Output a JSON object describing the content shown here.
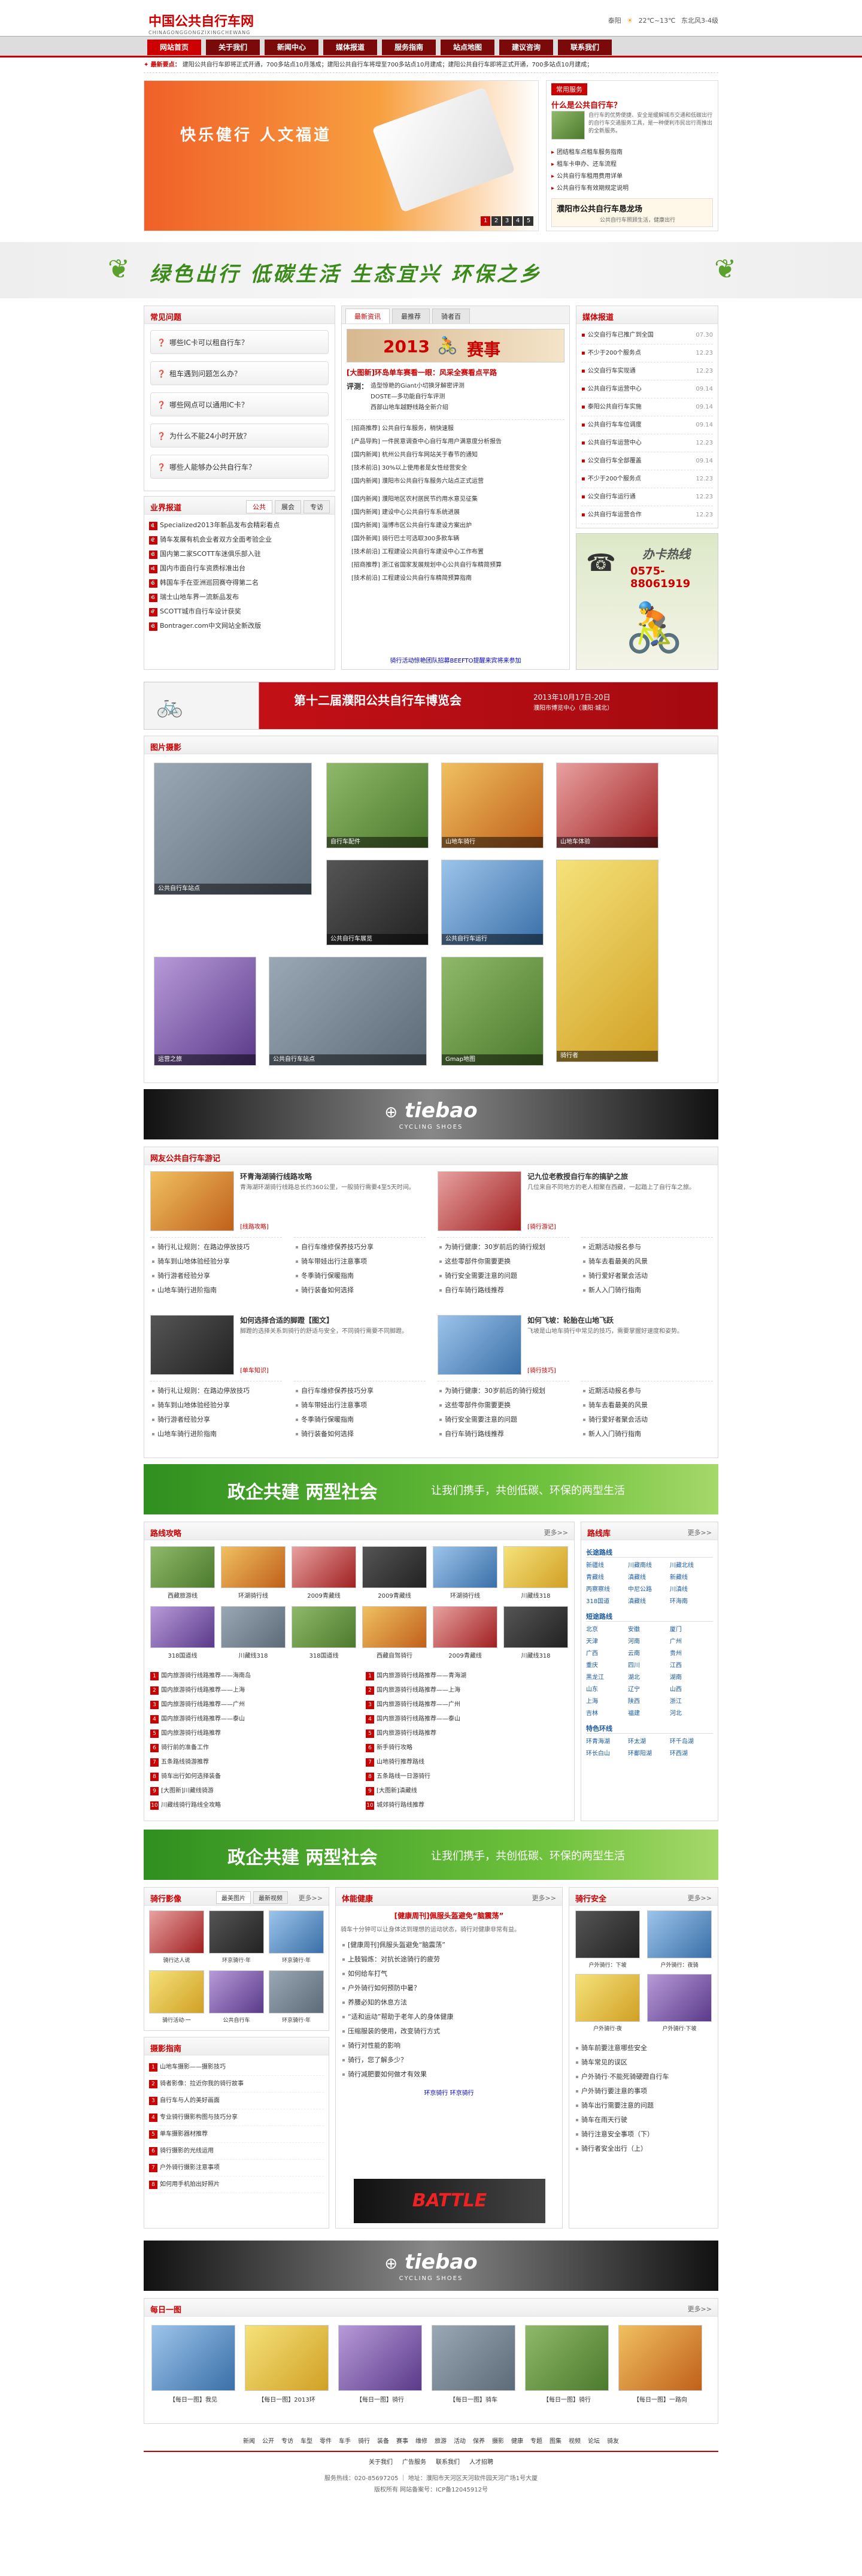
{
  "header": {
    "logo_cn": "中国公共自行车网",
    "logo_en": "CHINAGONGGONGZIXINGCHEWANG",
    "weather_city": "泰阳",
    "weather_temp": "22℃~13℃",
    "weather_wind": "东北风3-4级"
  },
  "nav": [
    "网站首页",
    "关于我们",
    "新闻中心",
    "媒体报道",
    "服务指南",
    "站点地图",
    "建议咨询",
    "联系我们"
  ],
  "notice": {
    "label": "最新要点：",
    "text": "建阳公共自行车即将正式开通，700多站点10月落成；建阳公共自行车将增至700多站点10月建成；建阳公共自行车即将正式开通，700多站点10月建成；"
  },
  "hero": {
    "slogan": "快乐健行 人文福道",
    "pages": [
      "1",
      "2",
      "3",
      "4",
      "5"
    ]
  },
  "intro": {
    "title": "常用服务",
    "question": "什么是公共自行车？",
    "desc": "自行车的优势便捷、安全是缓解城市交通和低碳出行的自行车交通服务工具，是一种便利市民出行而推出的全新服务。",
    "links": [
      "办理租车卡",
      "联系电话"
    ],
    "items": [
      "团结租车点租车服务指南",
      "租车卡申办、还车流程",
      "公共自行车租用费用详单",
      "公共自行车有效期规定说明"
    ],
    "ad_title": "濮阳市公共自行车恳龙场",
    "ad_sub": "公共自行车照顾生活，健康出行"
  },
  "slogan_bar": {
    "text": "绿色出行 低碳生活 生态宜兴 环保之乡"
  },
  "faq": {
    "title": "常见问题",
    "items": [
      "哪些IC卡可以租自行车？",
      "租车遇到问题怎么办？",
      "哪些网点可以通用IC卡？",
      "为什么不能24小时开放？",
      "哪些人能够办公共自行车？"
    ]
  },
  "yezhe": {
    "title": "业界报道",
    "tabs": [
      "公共",
      "展会",
      "专访"
    ],
    "items": [
      "Specialized2013年新品发布会精彩看点",
      "骑车发展有机会业者双方全面考验企业",
      "国内第二家SCOTT车迷俱乐部入驻",
      "国内市面自行车资质标准出台",
      "韩国车手在亚洲巡回赛夺得第二名",
      "瑞士山地车界一流新品发布",
      "SCOTT城市自行车设计获奖",
      "Bontrager.com中文网站全新改版"
    ]
  },
  "news": {
    "tabs": [
      "最新资讯",
      "最推荐",
      "骑者百"
    ],
    "banner_year": "2013",
    "banner_text": "赛事",
    "headline": "[大图新]环岛单车赛看一眼：风采全赛看点平路",
    "review_label": "评测：",
    "reviews": [
      "造型惊艳的Giant小切换牙解密评测",
      "DOSTE—多功能自行车评测",
      "西部山地车越野线路全新介绍"
    ],
    "items": [
      "[招商推荐] 公共自行车服务，稍快速服",
      "[产品导购] 一件民意调查中心自行车用户满意度分析报告",
      "[国内新闻] 杭州公共自行车网站关于春节的通知",
      "[技术前沿] 30%以上使用者是女性经营安全",
      "[国内新闻] 濮阳市公共自行车服务六站点正式运营",
      "[国内新闻] 濮阳地区农村居民节约用水意见征集",
      "[国内新闻] 建设中心公共自行车系统进展",
      "[国内新闻] 淄博市区公共自行车建设方案出炉",
      "[国外新闻] 骑行巴士可选取300多款车辆",
      "[技术前沿] 工程建设公共自行车建设中心工作布置",
      "[招商推荐] 浙江省国家发展规划中心公共自行车精简预算",
      "[技术前沿] 工程建设公共自行车精简预算指南"
    ],
    "footer": "骑行活动惊艳团队招募BEEFTO提醒来宾将来参加"
  },
  "media": {
    "title": "媒体报道",
    "items": [
      [
        "公交自行车已推广到全国",
        "07.30"
      ],
      [
        "不少于200个服务点",
        "12.23"
      ],
      [
        "公交自行车实现通",
        "12.23"
      ],
      [
        "公共自行车运营中心",
        "09.14"
      ],
      [
        "泰阳公共自行车实施",
        "09.14"
      ],
      [
        "公共自行车车位调度",
        "09.14"
      ],
      [
        "公共自行车运营中心",
        "12.23"
      ],
      [
        "公交自行车全部覆盖",
        "09.14"
      ],
      [
        "不少于200个服务点",
        "12.23"
      ],
      [
        "公交自行车运行通",
        "12.23"
      ],
      [
        "公共自行车运营合作",
        "12.23"
      ]
    ],
    "hotline_label": "办卡热线",
    "hotline": "0575-88061919"
  },
  "expo": {
    "title": "第十二届濮阳公共自行车博览会",
    "date": "2013年10月17日-20日",
    "place": "濮阳市博览中心（濮阳·城北）"
  },
  "photos": {
    "title": "图片摄影",
    "caps": [
      "公共自行车站点",
      "自行车配件",
      "山地车骑行",
      "山地车体验",
      "公共自行车展览",
      "公共自行车运行",
      "骑行者",
      "运营之旅",
      "公共自行车站点",
      "Gmap地图"
    ]
  },
  "ad_tiebao": {
    "brand": "tiebao",
    "sub": "CYCLING SHOES"
  },
  "travel": {
    "title": "网友公共自行车游记",
    "a": [
      {
        "title": "环青海湖骑行线路攻略",
        "desc": "青海湖环湖骑行线路总长约360公里，一般骑行需要4至5天时间。",
        "more": "[线路攻略]"
      },
      {
        "title": "记九位老教授自行车的搞驴之旅",
        "desc": "几位来自不同地方的老人相聚在西藏，一起踏上了自行车之旅。",
        "more": "[骑行游记]"
      },
      {
        "title": "如何选择合适的脚蹬【图文】",
        "desc": "脚蹬的选择关系到骑行的舒适与安全，不同骑行需要不同脚蹬。",
        "more": "[单车知识]"
      },
      {
        "title": "如何飞坡：轮胎在山地飞跃",
        "desc": "飞坡是山地车骑行中常见的技巧，需要掌握好速度和姿势。",
        "more": "[骑行技巧]"
      }
    ],
    "list1": [
      "骑行礼让规则：在路边停放技巧",
      "骑车到山地体验经验分享",
      "骑行游者经验分享",
      "山地车骑行进阶指南"
    ],
    "list2": [
      "自行车维修保养技巧分享",
      "骑车带娃出行注意事项",
      "冬季骑行保暖指南",
      "骑行装备如何选择"
    ],
    "list3": [
      "为骑行健康：30岁前后的骑行规划",
      "这些零部件你需要更换",
      "骑行安全需要注意的问题",
      "自行车骑行路线推荐"
    ],
    "list4": [
      "近期活动报名参与",
      "骑车去看最美的风景",
      "骑行爱好者聚会活动",
      "新人入门骑行指南"
    ]
  },
  "govbar1": {
    "big": "政企共建 两型社会",
    "small": "让我们携手，共创低碳、环保的两型生活"
  },
  "routes": {
    "title": "路线攻略",
    "more": "更多>>",
    "caps": [
      "西藏旅游线",
      "环湖骑行线",
      "2009青藏线",
      "2009青藏线",
      "环湖骑行线",
      "川藏线318",
      "318国道线",
      "川藏线318",
      "318国道线",
      "西藏自驾骑行",
      "2009青藏线",
      "川藏线318"
    ],
    "list": [
      "国内旅游骑行线路推荐——海南岛",
      "国内旅游骑行线路推荐——上海",
      "国内旅游骑行线路推荐——广州",
      "国内旅游骑行线路推荐——泰山",
      "国内旅游骑行线路推荐",
      "骑行前的准备工作",
      "五条路线骑游推荐",
      "骑车出行如何选择装备",
      "[大图新]川藏线骑游",
      "川藏线骑行路线全攻略"
    ],
    "list2": [
      "国内旅游骑行线路推荐——青海湖",
      "国内旅游骑行线路推荐——上海",
      "国内旅游骑行线路推荐——广州",
      "国内旅游骑行线路推荐——泰山",
      "国内旅游骑行线路推荐",
      "新手骑行攻略",
      "山地骑行推荐路线",
      "五条路线一日游骑行",
      "[大图新]滇藏线",
      "城郊骑行路线推荐"
    ]
  },
  "library": {
    "title": "路线库",
    "more": "更多>>",
    "groups": [
      {
        "name": "长途路线",
        "items": [
          "新疆线",
          "川藏南线",
          "川藏北线",
          "青藏线",
          "滇藏线",
          "新藏线",
          "丙察察线",
          "中尼公路",
          "川滇线",
          "318国道",
          "滇藏线",
          "环海南"
        ]
      },
      {
        "name": "短途路线",
        "items": [
          "北京",
          "安徽",
          "厦门",
          "天津",
          "河南",
          "广州",
          "广西",
          "云南",
          "贵州",
          "重庆",
          "四川",
          "江西",
          "黑龙江",
          "湖北",
          "湖南",
          "山东",
          "辽宁",
          "山西",
          "上海",
          "陕西",
          "浙江",
          "吉林",
          "福建",
          "河北"
        ]
      },
      {
        "name": "特色环线",
        "items": [
          "环青海湖",
          "环太湖",
          "环千岛湖",
          "环长白山",
          "环鄱阳湖",
          "环西湖"
        ]
      }
    ]
  },
  "govbar2": {
    "big": "政企共建 两型社会",
    "small": "让我们携手，共创低碳、环保的两型生活"
  },
  "qixing": {
    "title": "骑行影像",
    "tabs": [
      "最美图片",
      "最新视频"
    ],
    "more": "更多>>",
    "caps": [
      "骑行达人说",
      "环京骑行·年",
      "环京骑行·年",
      "骑行活动·一",
      "公共自行车",
      "环京骑行·年"
    ]
  },
  "guide": {
    "title": "摄影指南",
    "items": [
      "山地车摄影——摄影技巧",
      "骑者影像：拉近你我的骑行故事",
      "自行车与人的美好画面",
      "专业骑行摄影构图与技巧分享",
      "单车摄影器材推荐",
      "骑行摄影的光线运用",
      "户外骑行摄影注意事项",
      "如何用手机拍出好照片"
    ]
  },
  "health": {
    "title": "体能健康",
    "more": "更多>>",
    "headline": "[健康周刊]佩服头盔避免“脑震荡”",
    "desc": "骑车十分钟可以让身体达到理想的运动状态，骑行对健康非常有益。",
    "items": [
      "[健康周刊]佩服头盔避免“脑震荡”",
      "上肢锻炼：对抗长途骑行的疲劳",
      "如何给车打气",
      "户外骑行如何预防中暑？",
      "养腰必知的休息方法",
      "“适和运动”帮助于老年人的身体健康",
      "压缩服装的使用，改变骑行方式",
      "骑行对性能的影响",
      "骑行，您了解多少？",
      "骑行减肥要如何做才有效果"
    ],
    "foot": "环京骑行  环京骑行",
    "ad": "BATTLE"
  },
  "safety": {
    "title": "骑行安全",
    "more": "更多>>",
    "caps": [
      "户外骑行：下坡",
      "户外骑行：夜骑",
      "户外骑行·夜",
      "户外骑行·下坡"
    ],
    "items": [
      "骑车前要注意哪些安全",
      "骑车常见的误区",
      "户外骑行·不能死骑硬蹬自行车",
      "户外骑行要注意的事项",
      "骑车出行需要注意的问题",
      "骑车在雨天行驶",
      "骑行注意安全事项（下）",
      "骑行者安全出行（上）"
    ]
  },
  "daily": {
    "title": "每日一图",
    "more": "更多>>",
    "caps": [
      "【每日一图】我见",
      "【每日一图】2013环",
      "【每日一图】骑行",
      "【每日一图】骑车",
      "【每日一图】骑行",
      "【每日一图】一路向"
    ]
  },
  "footer_links": [
    "新闻",
    "公开",
    "专访",
    "车型",
    "零件",
    "车手",
    "骑行",
    "装备",
    "赛事",
    "维修",
    "旅游",
    "活动",
    "保养",
    "摄影",
    "健康",
    "专题",
    "图集",
    "视频",
    "论坛",
    "骑友"
  ],
  "footer": {
    "links2": [
      "关于我们",
      "广告服务",
      "联系我们",
      "人才招聘"
    ],
    "contact": "服务热线：020-85697205 ｜ 地址：濮阳市天河区天河软件园天河广场1号大厦",
    "icp": "版权所有 网站备案号：ICP备12045912号"
  }
}
